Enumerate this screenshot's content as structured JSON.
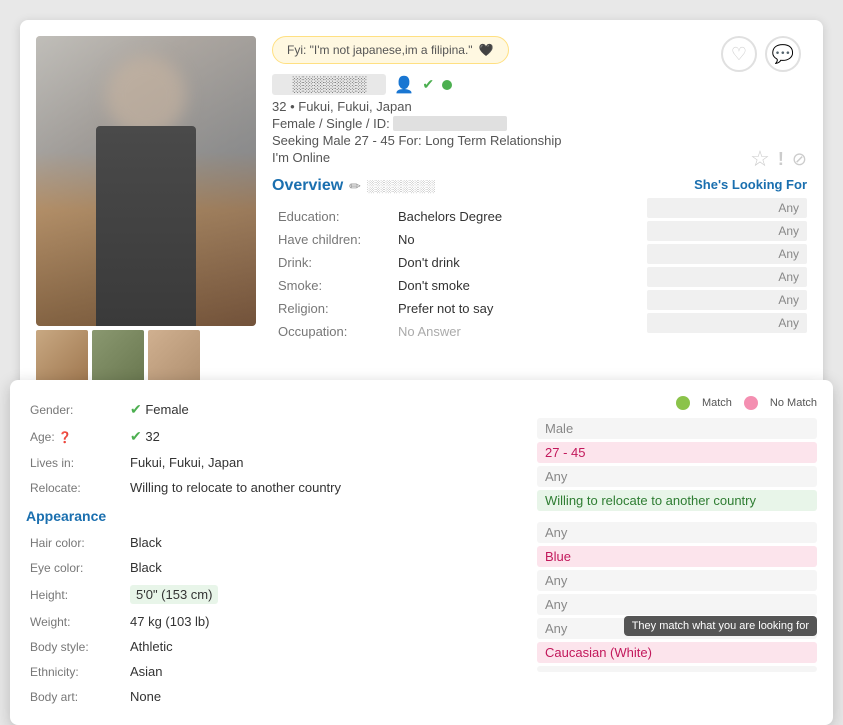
{
  "profile": {
    "quote": "Fyi: \"I'm not japanese,im a filipina.\"",
    "quote_emoji": "🖤",
    "username_blur": true,
    "age": "32",
    "location": "Fukui, Fukui, Japan",
    "gender_status_id": "Female / Single / ID:",
    "seeking": "Seeking Male 27 - 45 For: Long Term Relationship",
    "online_status": "I'm Online",
    "heart_button": "♡",
    "chat_button": "💬",
    "star_action": "☆",
    "exclaim_action": "!",
    "block_action": "⊘"
  },
  "overview": {
    "title": "Overview",
    "edit_icon": "✏",
    "rows": [
      {
        "label": "Education:",
        "value": "Bachelors Degree"
      },
      {
        "label": "Have children:",
        "value": "No"
      },
      {
        "label": "Drink:",
        "value": "Don't drink"
      },
      {
        "label": "Smoke:",
        "value": "Don't smoke"
      },
      {
        "label": "Religion:",
        "value": "Prefer not to say"
      },
      {
        "label": "Occupation:",
        "value": "No Answer"
      }
    ]
  },
  "looking_for": {
    "title": "She's Looking For",
    "items": [
      "Any",
      "Any",
      "Any",
      "Any",
      "Any",
      "Any"
    ]
  },
  "legend": {
    "match_label": "Match",
    "no_match_label": "No Match"
  },
  "details": {
    "basic": [
      {
        "label": "Gender:",
        "value": "Female",
        "highlight": "none",
        "has_icon": true
      },
      {
        "label": "Age:",
        "value": "32",
        "highlight": "none",
        "has_icon": true,
        "has_help": true
      },
      {
        "label": "Lives in:",
        "value": "Fukui, Fukui, Japan",
        "highlight": "none"
      },
      {
        "label": "Relocate:",
        "value": "Willing to relocate to another country",
        "highlight": "none"
      }
    ],
    "appearance_title": "Appearance",
    "appearance": [
      {
        "label": "Hair color:",
        "value": "Black",
        "highlight": "none"
      },
      {
        "label": "Eye color:",
        "value": "Black",
        "highlight": "none"
      },
      {
        "label": "Height:",
        "value": "5'0\" (153 cm)",
        "highlight": "green"
      },
      {
        "label": "Weight:",
        "value": "47 kg (103 lb)",
        "highlight": "none"
      },
      {
        "label": "Body style:",
        "value": "Athletic",
        "highlight": "none"
      },
      {
        "label": "Ethnicity:",
        "value": "Asian",
        "highlight": "none"
      },
      {
        "label": "Body art:",
        "value": "None",
        "highlight": "none"
      }
    ]
  },
  "right_panel": {
    "basic": [
      {
        "value": "Male",
        "type": "neutral"
      },
      {
        "value": "27 - 45",
        "type": "match-pink"
      },
      {
        "value": "Any",
        "type": "neutral"
      },
      {
        "value": "Willing to relocate to another country",
        "type": "match-green"
      }
    ],
    "appearance": [
      {
        "value": "Any",
        "type": "neutral"
      },
      {
        "value": "Blue",
        "type": "match-pink"
      },
      {
        "value": "Any",
        "type": "neutral"
      },
      {
        "value": "Any",
        "type": "neutral"
      },
      {
        "value": "Any",
        "type": "neutral"
      },
      {
        "value": "Caucasian (White)",
        "type": "match-pink"
      },
      {
        "value": "",
        "type": "neutral"
      }
    ],
    "tooltip": "They match what you are looking for"
  }
}
